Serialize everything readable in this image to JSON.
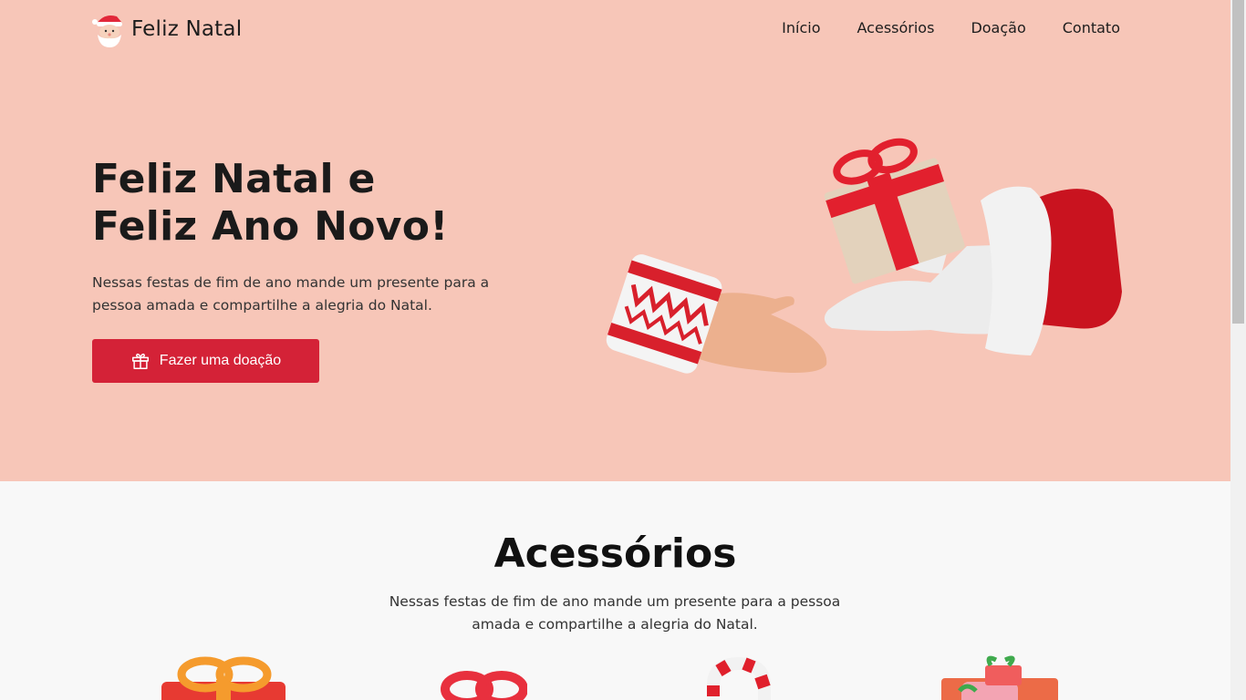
{
  "header": {
    "logo_text": "Feliz Natal",
    "nav": [
      "Início",
      "Acessórios",
      "Doação",
      "Contato"
    ]
  },
  "hero": {
    "title_line1": "Feliz Natal e",
    "title_line2": "Feliz Ano Novo!",
    "description": "Nessas festas de fim de ano mande um presente para a pessoa amada e compartilhe a alegria do Natal.",
    "cta_label": "Fazer uma doação"
  },
  "accessories": {
    "title": "Acessórios",
    "description": "Nessas festas de fim de ano mande um presente para a pessoa amada e compartilhe a alegria do Natal.",
    "items": [
      {
        "icon": "gift-box-orange-icon"
      },
      {
        "icon": "gift-bow-red-icon"
      },
      {
        "icon": "candy-cane-icon"
      },
      {
        "icon": "gift-stack-icon"
      }
    ]
  },
  "colors": {
    "hero_bg": "#f7c6b8",
    "accent": "#d42237",
    "page_bg": "#f8f8f8"
  }
}
